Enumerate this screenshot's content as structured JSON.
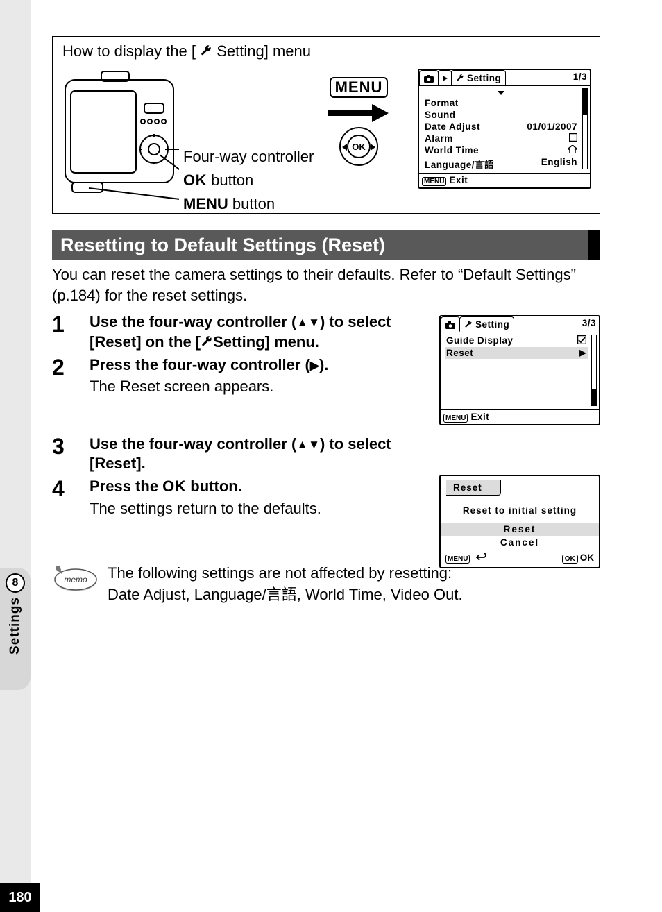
{
  "top_box": {
    "title_prefix": "How to display the [",
    "title_suffix": " Setting] menu",
    "labels": {
      "fourway": "Four-way controller",
      "ok_prefix": "OK",
      "ok_suffix": " button",
      "menu_prefix": "MENU",
      "menu_suffix": " button"
    },
    "menu_button": "MENU",
    "ok_inner": "OK"
  },
  "screen1": {
    "title": "Setting",
    "page": "1/3",
    "items": {
      "format": "Format",
      "sound": "Sound",
      "date_adjust": "Date Adjust",
      "date_value": "01/01/2007",
      "alarm": "Alarm",
      "world_time": "World Time",
      "language": "Language/言語",
      "language_value": "English"
    },
    "exit": "Exit",
    "menu_chip": "MENU"
  },
  "section_heading": "Resetting to Default Settings (Reset)",
  "intro": "You can reset the camera settings to their defaults. Refer to “Default Settings” (p.184) for the reset settings.",
  "steps": {
    "s1": {
      "num": "1",
      "head_a": "Use the four-way controller (",
      "head_b": ") to select [Reset] on the [",
      "head_c": "Setting] menu."
    },
    "s2": {
      "num": "2",
      "head_a": "Press the four-way controller (",
      "head_b": ").",
      "sub": "The Reset screen appears."
    },
    "s3": {
      "num": "3",
      "head_a": "Use the four-way controller (",
      "head_b": ") to select [Reset]."
    },
    "s4": {
      "num": "4",
      "head_a": "Press the ",
      "head_ok": "OK",
      "head_b": " button.",
      "sub": "The settings return to the defaults."
    }
  },
  "screen2": {
    "title": "Setting",
    "page": "3/3",
    "guide": "Guide Display",
    "reset": "Reset",
    "exit": "Exit",
    "menu_chip": "MENU"
  },
  "screen3": {
    "tab": "Reset",
    "msg": "Reset to initial setting",
    "opt_reset": "Reset",
    "opt_cancel": "Cancel",
    "menu_chip": "MENU",
    "ok_chip": "OK",
    "ok_label": "OK"
  },
  "memo": {
    "label": "memo",
    "line1": "The following settings are not affected by resetting:",
    "line2": "Date Adjust, Language/言語, World Time, Video Out."
  },
  "side": {
    "chapter": "8",
    "label": "Settings"
  },
  "page_number": "180"
}
